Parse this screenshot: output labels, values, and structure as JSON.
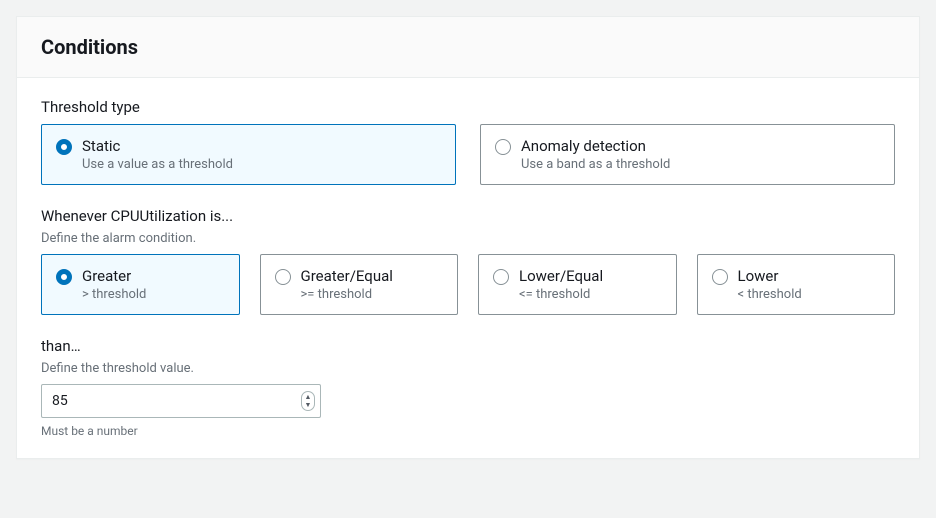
{
  "panel": {
    "title": "Conditions"
  },
  "thresholdType": {
    "label": "Threshold type",
    "options": [
      {
        "title": "Static",
        "sub": "Use a value as a threshold",
        "selected": true
      },
      {
        "title": "Anomaly detection",
        "sub": "Use a band as a threshold",
        "selected": false
      }
    ]
  },
  "condition": {
    "label": "Whenever CPUUtilization is...",
    "desc": "Define the alarm condition.",
    "options": [
      {
        "title": "Greater",
        "sub": "> threshold",
        "selected": true
      },
      {
        "title": "Greater/Equal",
        "sub": ">= threshold",
        "selected": false
      },
      {
        "title": "Lower/Equal",
        "sub": "<= threshold",
        "selected": false
      },
      {
        "title": "Lower",
        "sub": "< threshold",
        "selected": false
      }
    ]
  },
  "threshold": {
    "label": "than…",
    "desc": "Define the threshold value.",
    "value": "85",
    "hint": "Must be a number"
  }
}
